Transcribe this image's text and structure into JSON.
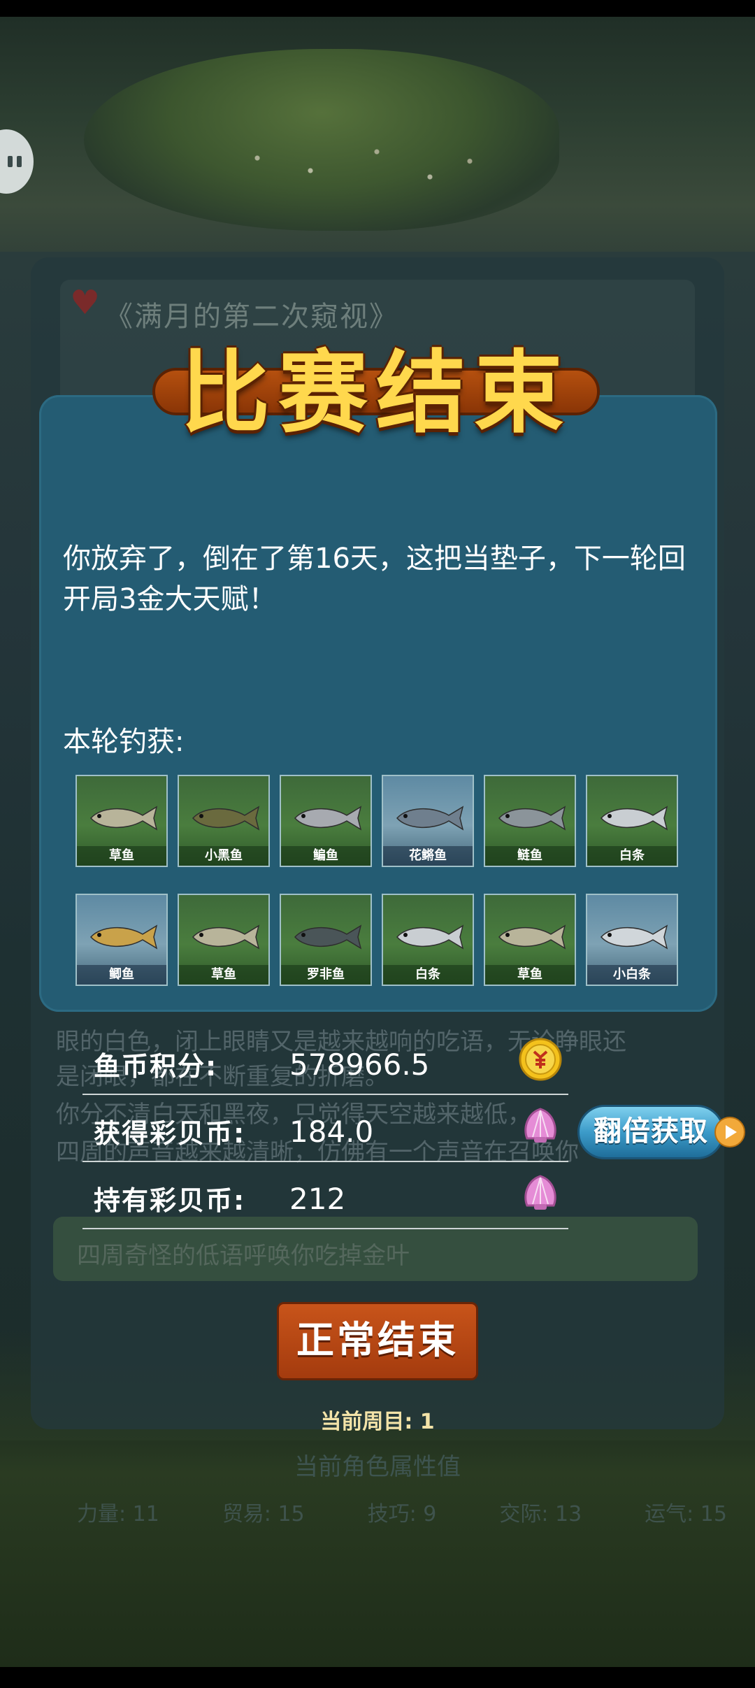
{
  "background": {
    "story_title": "《满月的第二次窥视》",
    "story_lines": [
      "眼的白色，闭上眼睛又是越来越响的吃语，无论睁眼还",
      "是闭眼，都在不断重复的折磨。",
      "你分不清白天和黑夜，只觉得天空越来越低，",
      "四周的声音越来越清晰，仿佛有一个声音在召唤你"
    ],
    "choice_text": "四周奇怪的低语呼唤你吃掉金叶",
    "attributes_title": "当前角色属性值",
    "attributes": [
      "力量: 11",
      "贸易: 15",
      "技巧: 9",
      "交际: 13",
      "运气: 15"
    ]
  },
  "modal": {
    "banner": "比赛结束",
    "message": "你放弃了，倒在了第16天，这把当垫子，下一轮回开局3金大天赋！",
    "catch_title": "本轮钓获:",
    "fish": [
      {
        "name": "草鱼",
        "bg": "green",
        "icon": "grass-carp-icon",
        "color": "#b8b49a"
      },
      {
        "name": "小黑鱼",
        "bg": "green",
        "icon": "snakehead-icon",
        "color": "#6a6a3e"
      },
      {
        "name": "鳊鱼",
        "bg": "green",
        "icon": "bream-icon",
        "color": "#a7aab0"
      },
      {
        "name": "花鳉鱼",
        "bg": "blue",
        "icon": "guppy-icon",
        "color": "#6f7f8e"
      },
      {
        "name": "鲢鱼",
        "bg": "green",
        "icon": "silver-carp-icon",
        "color": "#8b949a"
      },
      {
        "name": "白条",
        "bg": "green",
        "icon": "white-fish-icon",
        "color": "#c9ced2"
      },
      {
        "name": "鲫鱼",
        "bg": "blue",
        "icon": "crucian-carp-icon",
        "color": "#c9a24a"
      },
      {
        "name": "草鱼",
        "bg": "green",
        "icon": "grass-carp-icon",
        "color": "#b8b49a"
      },
      {
        "name": "罗非鱼",
        "bg": "green",
        "icon": "tilapia-icon",
        "color": "#4a5558"
      },
      {
        "name": "白条",
        "bg": "green",
        "icon": "white-fish-icon",
        "color": "#c9ced2"
      },
      {
        "name": "草鱼",
        "bg": "green",
        "icon": "grass-carp-icon",
        "color": "#b8b49a"
      },
      {
        "name": "小白条",
        "bg": "blue",
        "icon": "small-white-fish-icon",
        "color": "#d0d6da"
      }
    ]
  },
  "stats": {
    "fish_coin_label": "鱼币积分:",
    "fish_coin_value": "578966.5",
    "shell_earned_label": "获得彩贝币:",
    "shell_earned_value": "184.0",
    "shell_held_label": "持有彩贝币:",
    "shell_held_value": "212"
  },
  "double_button": "翻倍获取",
  "end_button": "正常结束",
  "cycle_text": "当前周目: 1",
  "colors": {
    "modal": "#245c73",
    "banner_text": "#ffd84d",
    "end_button": "#b5471a",
    "double_button": "#3c9bc9"
  }
}
